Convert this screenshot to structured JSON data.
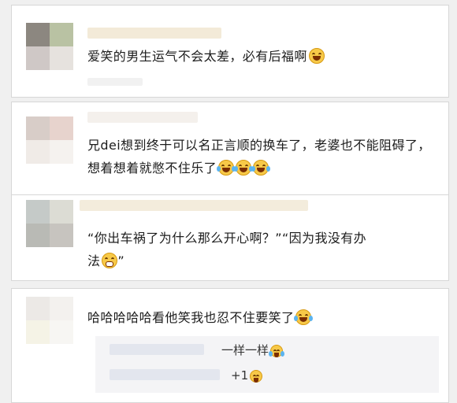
{
  "comments": [
    {
      "text": "爱笑的男生运气不会太差，必有后福啊",
      "emojis": [
        "laughing-face"
      ]
    },
    {
      "text": "兄dei想到终于可以名正言顺的换车了，老婆也不能阻碍了，想着想着就憋不住乐了",
      "emojis": [
        "tears-of-joy",
        "tears-of-joy",
        "tears-of-joy"
      ]
    },
    {
      "text_line1": "“你出车祸了为什么那么开心啊？”“因为我没有办",
      "text_line2": "法",
      "text_line2_end": "”",
      "emojis": [
        "grinning-teeth"
      ]
    },
    {
      "text": "哈哈哈哈哈看他笑我也忍不住要笑了",
      "emojis": [
        "tears-of-joy"
      ]
    }
  ],
  "replies": [
    {
      "text": "一样一样",
      "emojis": [
        "tears-of-joy"
      ]
    },
    {
      "text": "+1",
      "emojis": [
        "laughing-face"
      ]
    }
  ],
  "colors": {
    "card_bg": "#ffffff",
    "page_bg": "#f0f0f0",
    "emoji_yellow": "#f7c948",
    "reply_bg": "#f4f4f6"
  }
}
